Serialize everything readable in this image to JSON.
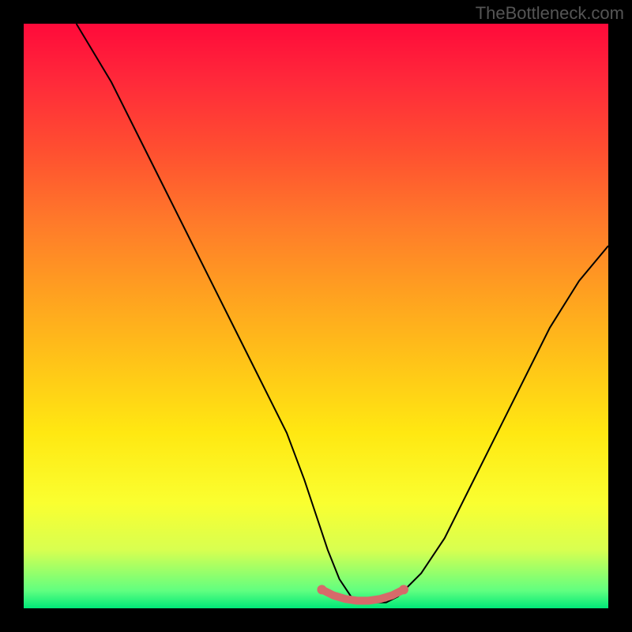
{
  "watermark": "TheBottleneck.com",
  "chart_data": {
    "type": "line",
    "title": "",
    "xlabel": "",
    "ylabel": "",
    "xlim": [
      0,
      100
    ],
    "ylim": [
      0,
      100
    ],
    "series": [
      {
        "name": "curve",
        "x": [
          9,
          15,
          20,
          25,
          30,
          35,
          40,
          45,
          48,
          50,
          52,
          54,
          56,
          58,
          60,
          62,
          64,
          68,
          72,
          76,
          80,
          85,
          90,
          95,
          100
        ],
        "y": [
          100,
          90,
          80,
          70,
          60,
          50,
          40,
          30,
          22,
          16,
          10,
          5,
          2,
          1,
          1,
          1,
          2,
          6,
          12,
          20,
          28,
          38,
          48,
          56,
          62
        ]
      },
      {
        "name": "highlight",
        "x": [
          51,
          53,
          55,
          57,
          59,
          61,
          63,
          65
        ],
        "y": [
          3.2,
          2.2,
          1.6,
          1.3,
          1.3,
          1.6,
          2.2,
          3.2
        ]
      }
    ],
    "highlight_color": "#d66a6a",
    "curve_color": "#000000",
    "background": {
      "type": "vertical-gradient",
      "stops": [
        {
          "pos": 0.0,
          "color": "#ff0a3a"
        },
        {
          "pos": 0.22,
          "color": "#ff5030"
        },
        {
          "pos": 0.46,
          "color": "#ffa020"
        },
        {
          "pos": 0.7,
          "color": "#ffe812"
        },
        {
          "pos": 0.9,
          "color": "#d8ff50"
        },
        {
          "pos": 1.0,
          "color": "#00e878"
        }
      ]
    }
  }
}
